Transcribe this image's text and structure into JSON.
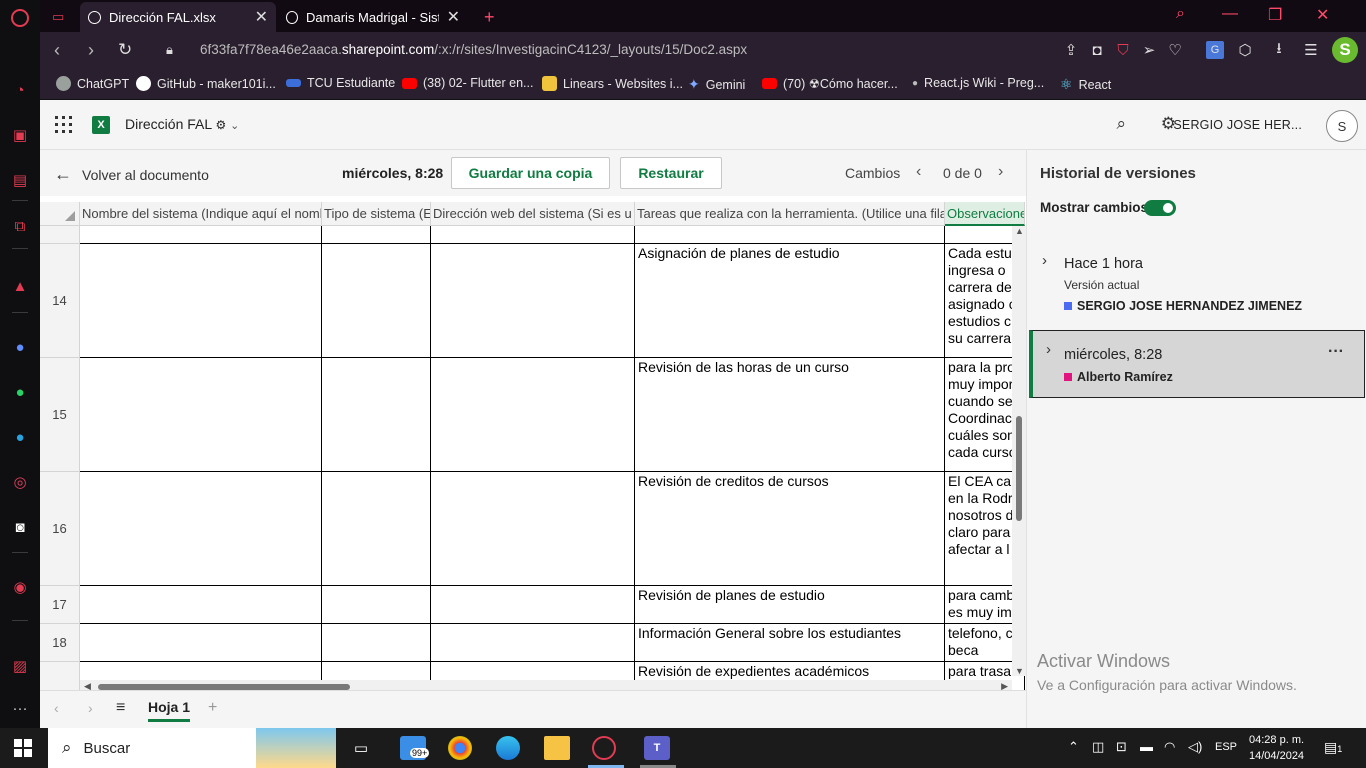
{
  "browser": {
    "tabs": [
      {
        "label": "Dirección FAL.xlsx",
        "active": true
      },
      {
        "label": "Damaris Madrigal - Sistema",
        "active": false
      }
    ],
    "new_tab": "+",
    "url_prefix": "6f33fa7f78ea46e2aaca.",
    "url_domain": "sharepoint.com",
    "url_path": "/:x:/r/sites/InvestigacinC4123/_layouts/15/Doc2.aspx",
    "profile_initial": "S",
    "accent": "#e23b52"
  },
  "bookmarks": [
    {
      "label": "ChatGPT",
      "color": "#9aa09c"
    },
    {
      "label": "GitHub - maker101i...",
      "color": "#ffffff"
    },
    {
      "label": "TCU Estudiante",
      "color": "#3b6ed9"
    },
    {
      "label": "(38) 02- Flutter en...",
      "color": "#ff0000"
    },
    {
      "label": "Linears - Websites i...",
      "color": "#f0c33c"
    },
    {
      "label": "Gemini",
      "color": "#7fa8ff"
    },
    {
      "label": "(70) ☢Cómo hacer...",
      "color": "#ff0000"
    },
    {
      "label": "React.js Wiki - Preg...",
      "color": "#2a2a2a"
    },
    {
      "label": "React",
      "color": "#61dafb"
    }
  ],
  "excel": {
    "app_letter": "X",
    "doc_title": "Dirección FAL",
    "user_name": "SERGIO JOSE HER...",
    "avatar_initial": "S",
    "brand_color": "#107c41"
  },
  "toolbar": {
    "back_label": "Volver al documento",
    "version_time": "miércoles, 8:28",
    "save_copy_label": "Guardar una copia",
    "restore_label": "Restaurar",
    "changes_label": "Cambios",
    "changes_count": "0 de 0"
  },
  "grid": {
    "columns": [
      "Nombre del sistema (Indique aquí el nombre",
      "Tipo de sistema (E",
      "Dirección web del sistema (Si es u",
      "Tareas que realiza con la herramienta. (Utilice una fila",
      "Observaciones"
    ],
    "rows": [
      {
        "num": "14",
        "cells": [
          "",
          "",
          "",
          "Asignación de planes de estudio",
          "Cada estu\ningresa o\ncarrera de\nasignado c\nestudios c\nsu carrera"
        ]
      },
      {
        "num": "15",
        "cells": [
          "",
          "",
          "",
          "Revisión de las horas de un curso",
          "para la pro\nmuy impor\ncuando se\nCoordinac\ncuáles son\ncada curso"
        ]
      },
      {
        "num": "16",
        "cells": [
          "",
          "",
          "",
          "Revisión de creditos de cursos",
          "El CEA ca\nen la Rodr\nnosotros d\nclaro para\nafectar a l"
        ]
      },
      {
        "num": "17",
        "cells": [
          "",
          "",
          "",
          "Revisión de planes de estudio",
          "para camb\nes muy im"
        ]
      },
      {
        "num": "18",
        "cells": [
          "",
          "",
          "",
          "Información General sobre los estudiantes",
          "telefono, c\nbeca"
        ]
      },
      {
        "num": "",
        "cells": [
          "",
          "",
          "",
          "Revisión de expedientes académicos",
          "para trasa"
        ]
      }
    ]
  },
  "sheets": {
    "active": "Hoja 1",
    "add": "+"
  },
  "versions": {
    "title": "Historial de versiones",
    "show_changes_label": "Mostrar cambios",
    "show_changes": true,
    "items": [
      {
        "title": "Hace 1 hora",
        "subtitle": "Versión actual",
        "author": "SERGIO JOSE HERNANDEZ JIMENEZ",
        "author_color": "#4a6cf0"
      },
      {
        "title": "miércoles, 8:28",
        "subtitle": "",
        "author": "Alberto Ramírez",
        "author_color": "#e0137f",
        "more": "···"
      }
    ]
  },
  "watermark": {
    "title": "Activar Windows",
    "subtitle": "Ve a Configuración para activar Windows."
  },
  "taskbar": {
    "search_placeholder": "Buscar",
    "mail_badge": "99+",
    "language": "ESP",
    "time": "04:28 p. m.",
    "date": "14/04/2024",
    "notifications": "1"
  }
}
